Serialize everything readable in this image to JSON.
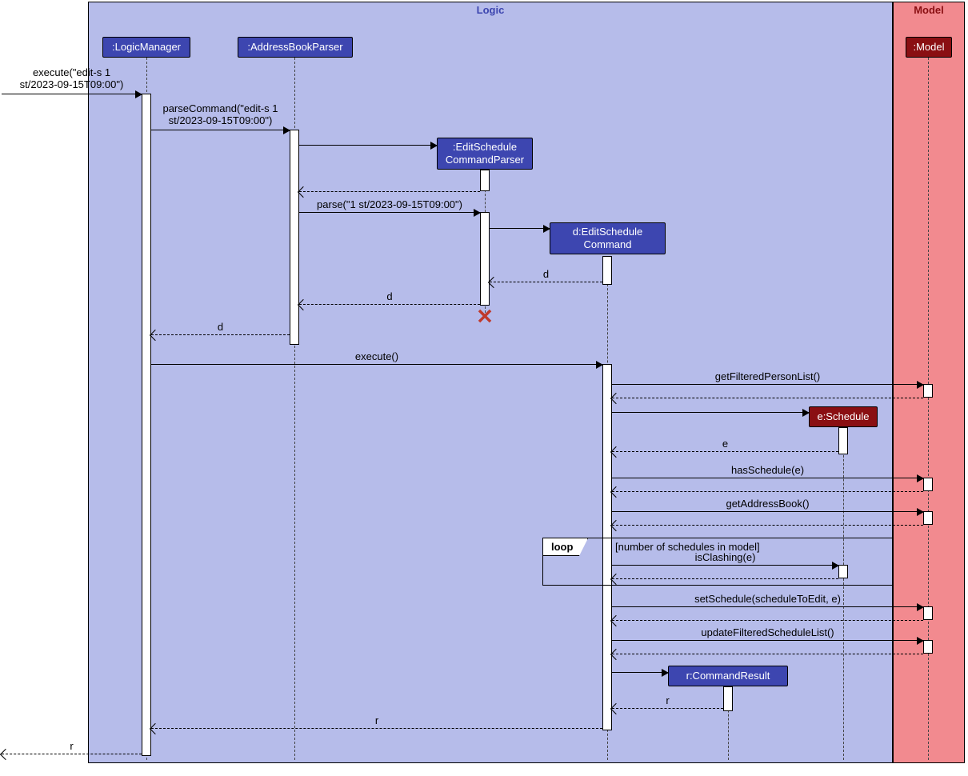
{
  "regions": {
    "logic": "Logic",
    "model": "Model"
  },
  "participants": {
    "logicManager": ":LogicManager",
    "addressBookParser": ":AddressBookParser",
    "editScheduleCommandParser": ":EditSchedule\nCommandParser",
    "editScheduleCommand": "d:EditSchedule\nCommand",
    "schedule": "e:Schedule",
    "commandResult": "r:CommandResult",
    "model": ":Model"
  },
  "messages": {
    "execute_entry": "execute(\"edit-s 1\nst/2023-09-15T09:00\")",
    "parseCommand": "parseCommand(\"edit-s 1\nst/2023-09-15T09:00\")",
    "parse": "parse(\"1 st/2023-09-15T09:00\")",
    "return_d1": "d",
    "return_d2": "d",
    "return_d3": "d",
    "executeCall": "execute()",
    "getFilteredPersonList": "getFilteredPersonList()",
    "return_e": "e",
    "hasSchedule": "hasSchedule(e)",
    "getAddressBook": "getAddressBook()",
    "isClashing": "isClashing(e)",
    "setSchedule": "setSchedule(scheduleToEdit, e)",
    "updateFilteredScheduleList": "updateFilteredScheduleList()",
    "return_r1": "r",
    "return_r2": "r",
    "return_r3": "r"
  },
  "fragment": {
    "label": "loop",
    "guard": "[number of schedules in model]"
  }
}
